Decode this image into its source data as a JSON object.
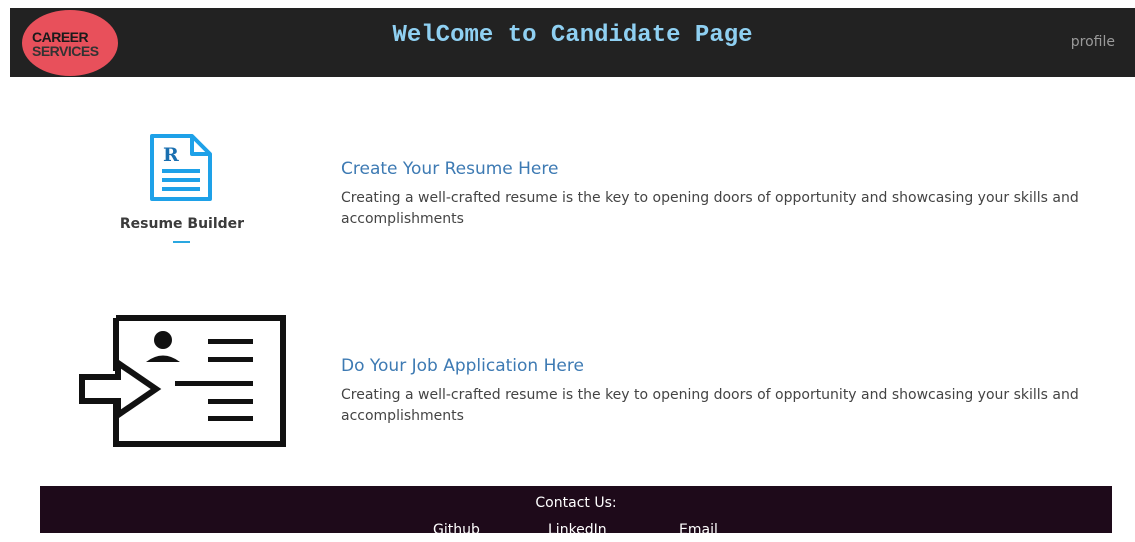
{
  "header": {
    "logo_line1": "CAREER",
    "logo_line2": "SERVICES",
    "title": "WelCome to Candidate Page",
    "profile_label": "profile"
  },
  "sections": [
    {
      "icon": "resume-document-icon",
      "icon_label": "Resume Builder",
      "title": "Create Your Resume Here",
      "description": "Creating a well-crafted resume is the key to opening doors of opportunity and showcasing your skills and accomplishments"
    },
    {
      "icon": "job-application-card-icon",
      "title": "Do Your Job Application Here",
      "description": "Creating a well-crafted resume is the key to opening doors of opportunity and showcasing your skills and accomplishments"
    }
  ],
  "footer": {
    "title": "Contact Us:",
    "links": [
      "Github",
      "LinkedIn",
      "Email"
    ]
  },
  "colors": {
    "header_bg": "#222222",
    "title_color": "#8fd0f2",
    "logo_bg": "#e8505b",
    "link_blue": "#3d7ab3",
    "icon_blue": "#1ea1e8",
    "footer_bg": "#1e0a1a"
  }
}
